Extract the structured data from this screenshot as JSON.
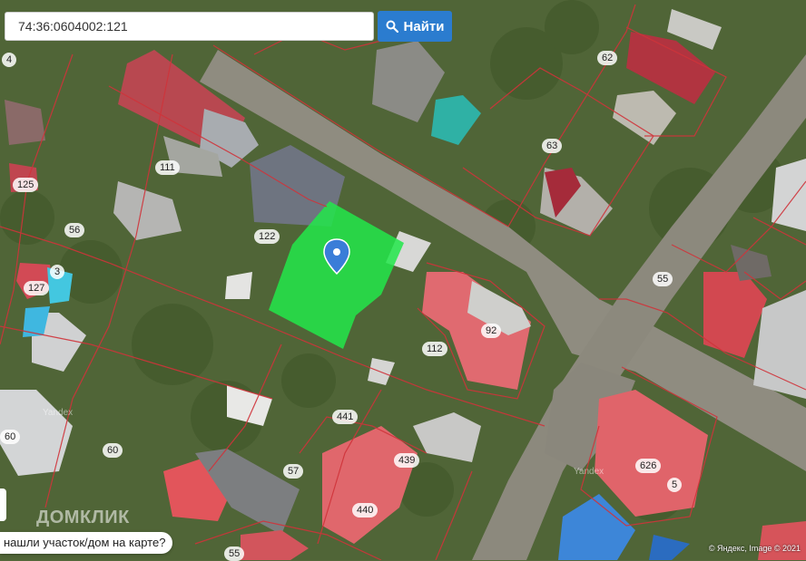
{
  "search": {
    "value": "74:36:0604002:121",
    "button_label": "Найти"
  },
  "hint_text": "нашли участок/дом на карте?",
  "watermark": "ДОМКЛИК",
  "attribution": "© Яндекс, Image © 2021",
  "yandex_watermarks": [
    "Yandex",
    "Yandex"
  ],
  "parcel_labels": [
    "62",
    "63",
    "111",
    "125",
    "56",
    "122",
    "3",
    "127",
    "55",
    "92",
    "112",
    "441",
    "60",
    "60",
    "57",
    "439",
    "440",
    "626",
    "5",
    "55",
    "4"
  ],
  "colors": {
    "accent": "#2b7ccf",
    "selected_parcel": "#22e84a",
    "parcel_border": "#c0392b",
    "pin": "#3a7dd8"
  }
}
